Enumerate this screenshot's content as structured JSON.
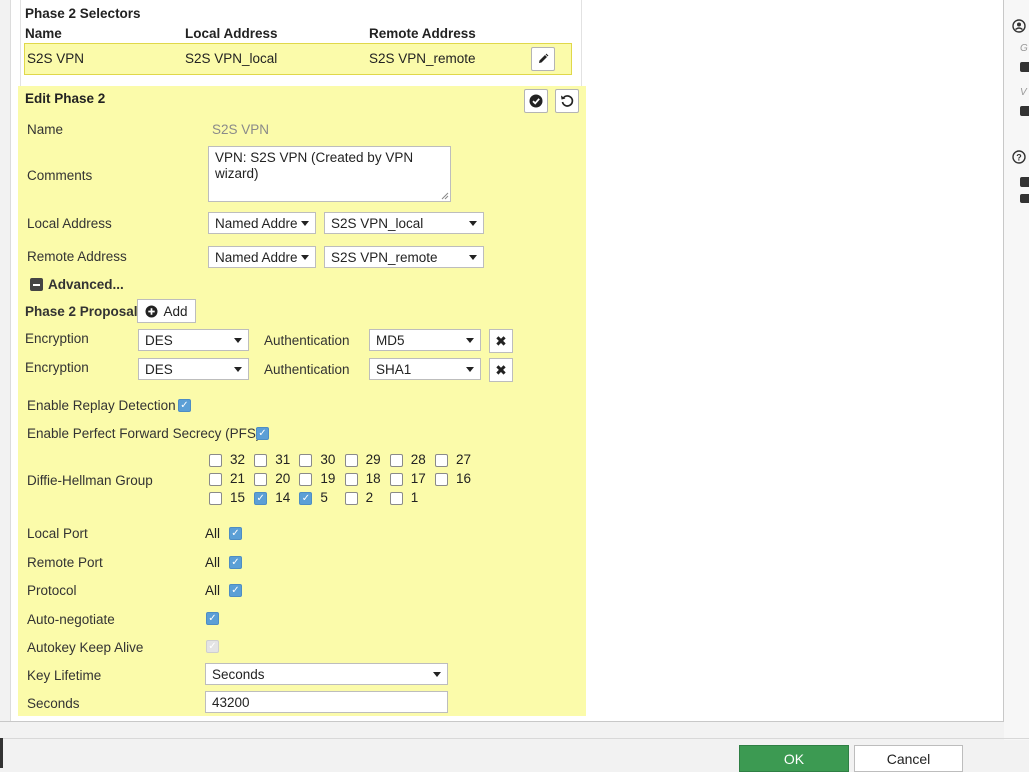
{
  "selectors": {
    "title": "Phase 2 Selectors",
    "headers": [
      "Name",
      "Local Address",
      "Remote Address"
    ],
    "row": {
      "name": "S2S VPN",
      "local": "S2S VPN_local",
      "remote": "S2S VPN_remote"
    }
  },
  "edit": {
    "title": "Edit Phase 2",
    "name_label": "Name",
    "name_value": "S2S VPN",
    "comments_label": "Comments",
    "comments_value": "VPN: S2S VPN (Created by VPN\nwizard)",
    "local_address_label": "Local Address",
    "local_type": "Named Addre",
    "local_value": "S2S VPN_local",
    "remote_address_label": "Remote Address",
    "remote_type": "Named Addre",
    "remote_value": "S2S VPN_remote",
    "advanced_label": "Advanced...",
    "proposal_label": "Phase 2 Proposal",
    "add_label": "Add",
    "proposals": [
      {
        "enc_label": "Encryption",
        "enc": "DES",
        "auth_label": "Authentication",
        "auth": "MD5"
      },
      {
        "enc_label": "Encryption",
        "enc": "DES",
        "auth_label": "Authentication",
        "auth": "SHA1"
      }
    ],
    "replay_label": "Enable Replay Detection",
    "replay_checked": true,
    "pfs_label": "Enable Perfect Forward Secrecy (PFS)",
    "pfs_checked": true,
    "dh_label": "Diffie-Hellman Group",
    "dh_groups": [
      {
        "value": "32",
        "checked": false
      },
      {
        "value": "31",
        "checked": false
      },
      {
        "value": "30",
        "checked": false
      },
      {
        "value": "29",
        "checked": false
      },
      {
        "value": "28",
        "checked": false
      },
      {
        "value": "27",
        "checked": false
      },
      {
        "value": "21",
        "checked": false
      },
      {
        "value": "20",
        "checked": false
      },
      {
        "value": "19",
        "checked": false
      },
      {
        "value": "18",
        "checked": false
      },
      {
        "value": "17",
        "checked": false
      },
      {
        "value": "16",
        "checked": false
      },
      {
        "value": "15",
        "checked": false
      },
      {
        "value": "14",
        "checked": true
      },
      {
        "value": "5",
        "checked": true
      },
      {
        "value": "2",
        "checked": false
      },
      {
        "value": "1",
        "checked": false
      }
    ],
    "local_port_label": "Local Port",
    "local_port_value": "All",
    "remote_port_label": "Remote Port",
    "remote_port_value": "All",
    "protocol_label": "Protocol",
    "protocol_value": "All",
    "autoneg_label": "Auto-negotiate",
    "autokey_label": "Autokey Keep Alive",
    "key_lifetime_label": "Key Lifetime",
    "key_lifetime_value": "Seconds",
    "seconds_label": "Seconds",
    "seconds_value": "43200"
  },
  "footer": {
    "ok_label": "OK",
    "cancel_label": "Cancel"
  },
  "sidebar": {
    "letters": [
      "G",
      "V"
    ]
  },
  "colors": {
    "edit_bg": "#fbfbaa",
    "ok_green": "#3c9a52",
    "check_blue": "#5b9fd6"
  }
}
